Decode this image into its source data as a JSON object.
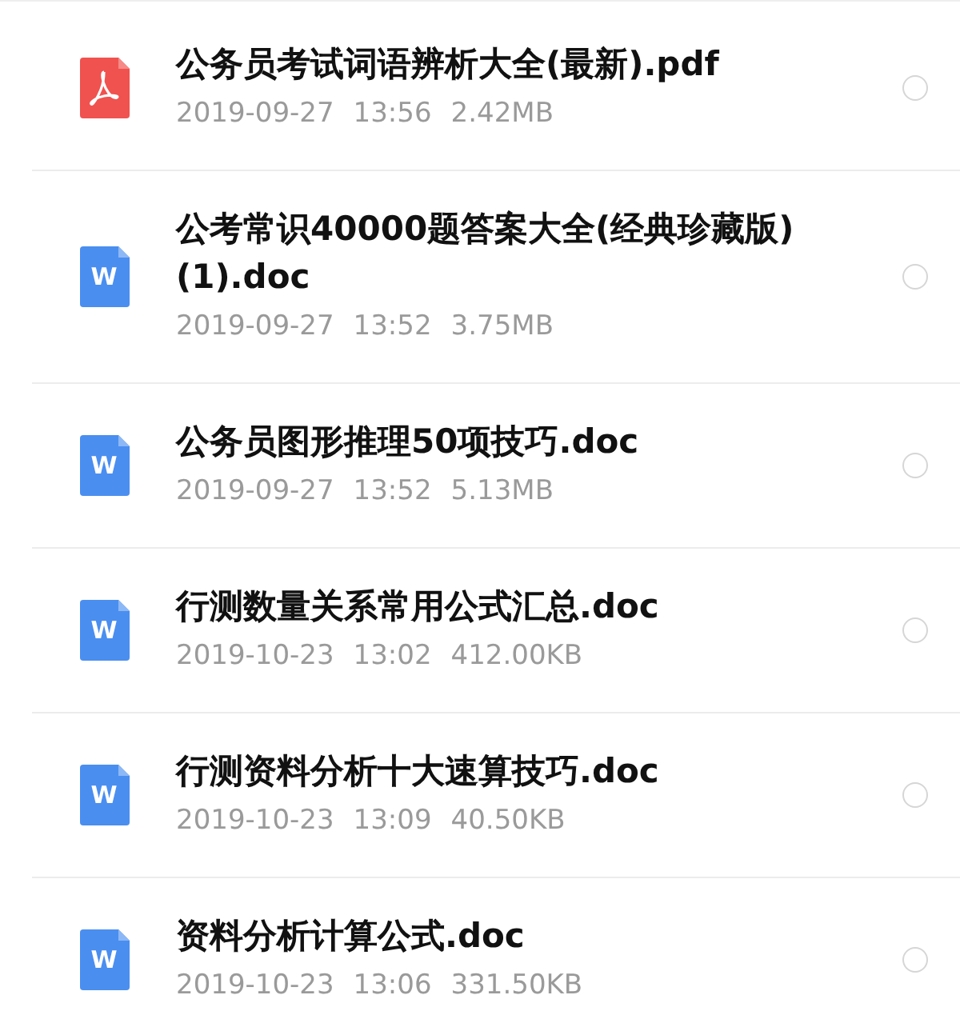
{
  "files": [
    {
      "kind": "pdf",
      "name": "公务员考试词语辨析大全(最新).pdf",
      "date": "2019-09-27",
      "time": "13:56",
      "size": "2.42MB",
      "selected": false
    },
    {
      "kind": "doc",
      "icon_text": "W",
      "name": "公考常识40000题答案大全(经典珍藏版)(1).doc",
      "date": "2019-09-27",
      "time": "13:52",
      "size": "3.75MB",
      "selected": false
    },
    {
      "kind": "doc",
      "icon_text": "W",
      "name": "公务员图形推理50项技巧.doc",
      "date": "2019-09-27",
      "time": "13:52",
      "size": "5.13MB",
      "selected": false
    },
    {
      "kind": "doc",
      "icon_text": "W",
      "name": "行测数量关系常用公式汇总.doc",
      "date": "2019-10-23",
      "time": "13:02",
      "size": "412.00KB",
      "selected": false
    },
    {
      "kind": "doc",
      "icon_text": "W",
      "name": "行测资料分析十大速算技巧.doc",
      "date": "2019-10-23",
      "time": "13:09",
      "size": "40.50KB",
      "selected": false
    },
    {
      "kind": "doc",
      "icon_text": "W",
      "name": "资料分析计算公式.doc",
      "date": "2019-10-23",
      "time": "13:06",
      "size": "331.50KB",
      "selected": false
    }
  ]
}
